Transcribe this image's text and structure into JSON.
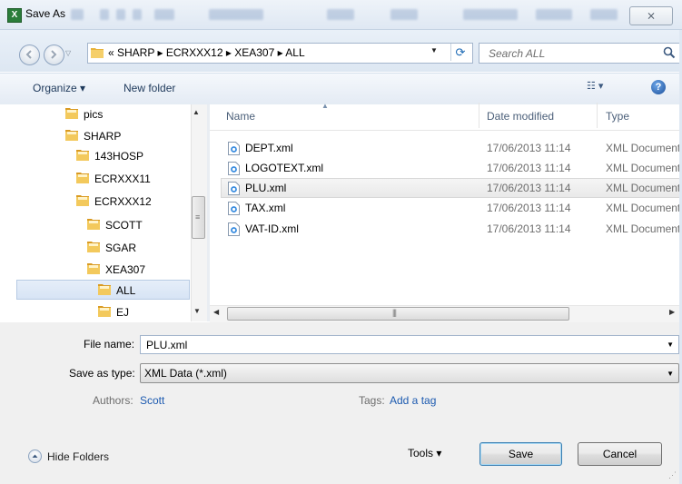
{
  "window": {
    "title": "Save As",
    "app_icon": "X",
    "close_glyph": "⨯"
  },
  "address": {
    "path": "« SHARP ▸ ECRXXX12 ▸ XEA307 ▸ ALL",
    "refresh_glyph": "⟳"
  },
  "search": {
    "placeholder": "Search ALL"
  },
  "toolbar": {
    "organize_label": "Organize ▾",
    "new_folder_label": "New folder",
    "views_glyph": "☷ ▾",
    "help_glyph": "?"
  },
  "nav": {
    "items": [
      {
        "label": "pics",
        "indent": 0
      },
      {
        "label": "SHARP",
        "indent": 0
      },
      {
        "label": "143HOSP",
        "indent": 1
      },
      {
        "label": "ECRXXX11",
        "indent": 1
      },
      {
        "label": "ECRXXX12",
        "indent": 1
      },
      {
        "label": "SCOTT",
        "indent": 2
      },
      {
        "label": "SGAR",
        "indent": 2
      },
      {
        "label": "XEA307",
        "indent": 2
      },
      {
        "label": "ALL",
        "indent": 3,
        "selected": true
      },
      {
        "label": "EJ",
        "indent": 3
      }
    ]
  },
  "columns": {
    "name": "Name",
    "date": "Date modified",
    "type": "Type"
  },
  "files": [
    {
      "name": "DEPT.xml",
      "date": "17/06/2013 11:14",
      "type": "XML Document"
    },
    {
      "name": "LOGOTEXT.xml",
      "date": "17/06/2013 11:14",
      "type": "XML Document"
    },
    {
      "name": "PLU.xml",
      "date": "17/06/2013 11:14",
      "type": "XML Document",
      "selected": true
    },
    {
      "name": "TAX.xml",
      "date": "17/06/2013 11:14",
      "type": "XML Document"
    },
    {
      "name": "VAT-ID.xml",
      "date": "17/06/2013 11:14",
      "type": "XML Document"
    }
  ],
  "form": {
    "filename_label": "File name:",
    "filename_value": "PLU.xml",
    "type_label": "Save as type:",
    "type_value": "XML Data (*.xml)",
    "authors_label": "Authors:",
    "authors_value": "Scott",
    "tags_label": "Tags:",
    "tags_value": "Add a tag"
  },
  "footer": {
    "hide_folders_label": "Hide Folders",
    "tools_label": "Tools  ▾",
    "save_label": "Save",
    "cancel_label": "Cancel"
  },
  "colors": {
    "accent": "#1c5ab0",
    "folder": "#e8b33a",
    "selection": "#d7e4f5"
  }
}
